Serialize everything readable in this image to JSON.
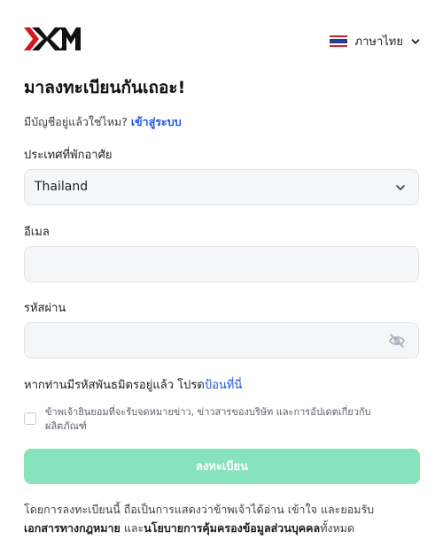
{
  "brand": {
    "logo_text": "XM"
  },
  "language": {
    "label": "ภาษาไทย",
    "flag": "thai-flag-icon"
  },
  "heading": "มาลงทะเบียนกันเถอะ!",
  "login_prompt": {
    "text": "มีบัญชีอยู่แล้วใช่ไหม?",
    "link": "เข้าสู่ระบบ"
  },
  "country": {
    "label": "ประเทศที่พักอาศัย",
    "value": "Thailand"
  },
  "email": {
    "label": "อีเมล",
    "value": "",
    "placeholder": ""
  },
  "password": {
    "label": "รหัสผ่าน",
    "value": "",
    "placeholder": ""
  },
  "referral": {
    "text": "หากท่านมีรหัสพันธมิตรอยู่แล้ว โปรด",
    "link": "ป้อนที่นี่"
  },
  "newsletter": {
    "checked": false,
    "text": "ข้าพเจ้ายินยอมที่จะรับจดหมายข่าว, ข่าวสารของบริษัท และการอัปเดตเกี่ยวกับผลิตภัณฑ์"
  },
  "submit_label": "ลงทะเบียน",
  "terms": {
    "line1": "โดยการลงทะเบียนนี้ ถือเป็นการแสดงว่าข้าพเจ้าได้อ่าน เข้าใจ และยอมรับ",
    "bold1": "เอกสารทางกฎหมาย",
    "mid": " และ",
    "bold2": "นโยบายการคุ้มครองข้อมูลส่วนบุคคล",
    "tail": "ทั้งหมด"
  },
  "colors": {
    "accent": "#1f55e5",
    "button": "#86e3bb",
    "logo_red": "#d51820"
  }
}
